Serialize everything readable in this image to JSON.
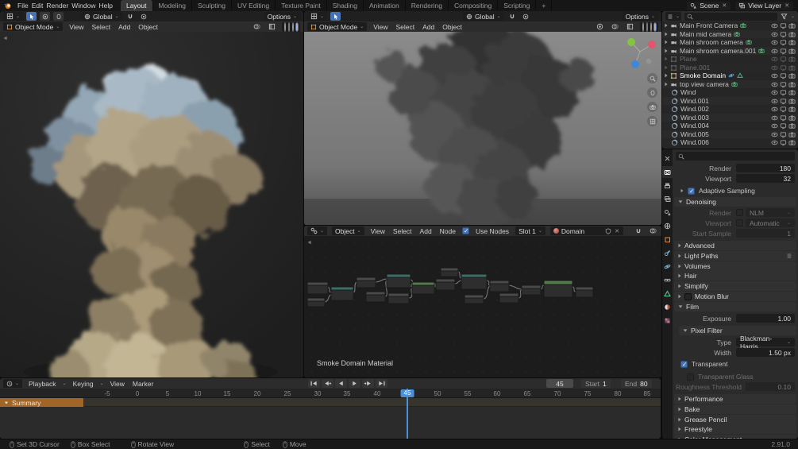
{
  "topbar": {
    "menus": [
      "File",
      "Edit",
      "Render",
      "Window",
      "Help"
    ],
    "workspaces": [
      "Layout",
      "Modeling",
      "Sculpting",
      "UV Editing",
      "Texture Paint",
      "Shading",
      "Animation",
      "Rendering",
      "Compositing",
      "Scripting"
    ],
    "add_tab": "+",
    "scene_name": "Scene",
    "view_layer_name": "View Layer"
  },
  "viewport": {
    "mode": "Object Mode",
    "menu_view": "View",
    "menu_select": "Select",
    "menu_add": "Add",
    "menu_object": "Object",
    "orientation": "Global",
    "options": "Options"
  },
  "node_editor": {
    "shader_type": "Object",
    "menu_view": "View",
    "menu_select": "Select",
    "menu_add": "Add",
    "menu_node": "Node",
    "use_nodes": "Use Nodes",
    "slot": "Slot 1",
    "material_name": "Smoke Domain Mat...",
    "node_label": "Smoke Domain Material"
  },
  "outliner": {
    "items": [
      {
        "name": "Main Front Camera"
      },
      {
        "name": "Main mid camera"
      },
      {
        "name": "Main shroom camera"
      },
      {
        "name": "Main shroom camera.001"
      },
      {
        "name": "Plane"
      },
      {
        "name": "Plane.001"
      },
      {
        "name": "Smoke Domain"
      },
      {
        "name": "top view camera"
      },
      {
        "name": "Wind"
      },
      {
        "name": "Wind.001"
      },
      {
        "name": "Wind.002"
      },
      {
        "name": "Wind.003"
      },
      {
        "name": "Wind.004"
      },
      {
        "name": "Wind.005"
      },
      {
        "name": "Wind.006"
      }
    ]
  },
  "properties": {
    "render_label": "Render",
    "render_samples": "180",
    "viewport_label": "Viewport",
    "viewport_samples": "32",
    "adaptive_sampling": "Adaptive Sampling",
    "denoising": "Denoising",
    "denoise_render_label": "Render",
    "denoise_render_value": "NLM",
    "denoise_viewport_label": "Viewport",
    "denoise_viewport_value": "Automatic",
    "start_sample_label": "Start Sample",
    "start_sample_value": "1",
    "advanced": "Advanced",
    "light_paths": "Light Paths",
    "volumes": "Volumes",
    "hair": "Hair",
    "simplify": "Simplify",
    "motion_blur": "Motion Blur",
    "film": "Film",
    "exposure_label": "Exposure",
    "exposure_value": "1.00",
    "pixel_filter": "Pixel Filter",
    "type_label": "Type",
    "type_value": "Blackman-Harris",
    "width_label": "Width",
    "width_value": "1.50 px",
    "transparent": "Transparent",
    "transparent_glass": "Transparent Glass",
    "roughness_label": "Roughness Threshold",
    "roughness_value": "0.10",
    "performance": "Performance",
    "bake": "Bake",
    "grease_pencil": "Grease Pencil",
    "freestyle": "Freestyle",
    "color_management": "Color Management"
  },
  "timeline": {
    "menu_playback": "Playback",
    "menu_keying": "Keying",
    "menu_view": "View",
    "menu_marker": "Marker",
    "current_frame": "45",
    "start_label": "Start",
    "start_value": "1",
    "end_label": "End",
    "end_value": "80",
    "summary": "Summary",
    "ruler": [
      "-5",
      "0",
      "5",
      "10",
      "15",
      "20",
      "25",
      "30",
      "35",
      "40",
      "45",
      "50",
      "55",
      "60",
      "65",
      "70",
      "75",
      "80",
      "85"
    ]
  },
  "statusbar": {
    "items": [
      "Set 3D Cursor",
      "Box Select",
      "Rotate View",
      "Select",
      "Move"
    ],
    "version": "2.91.0"
  }
}
